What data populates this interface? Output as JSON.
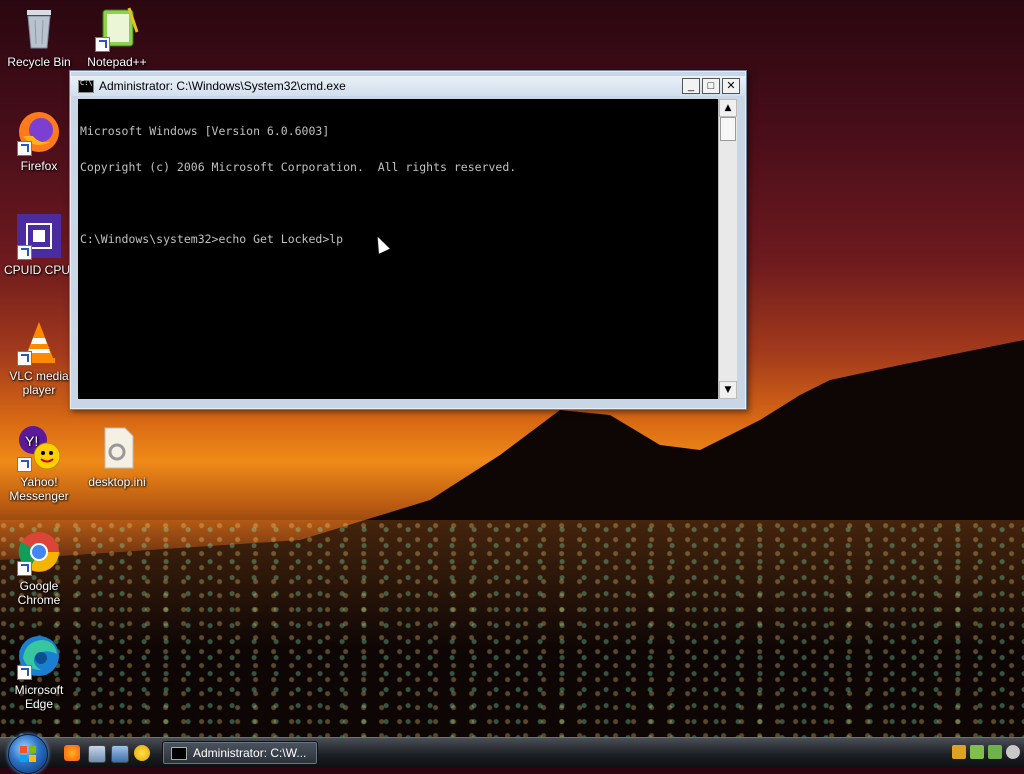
{
  "desktop": {
    "icons": [
      {
        "label": "Recycle Bin"
      },
      {
        "label": "Notepad++"
      },
      {
        "label": "Firefox"
      },
      {
        "label": "CPUID CPU-"
      },
      {
        "label": "VLC media player"
      },
      {
        "label": "Yahoo! Messenger"
      },
      {
        "label": "desktop.ini"
      },
      {
        "label": "Google Chrome"
      },
      {
        "label": "Microsoft Edge"
      }
    ]
  },
  "window": {
    "title": "Administrator: C:\\Windows\\System32\\cmd.exe",
    "console_lines": [
      "Microsoft Windows [Version 6.0.6003]",
      "Copyright (c) 2006 Microsoft Corporation.  All rights reserved.",
      "",
      "C:\\Windows\\system32>echo Get Locked>lp"
    ],
    "controls": {
      "minimize": "_",
      "maximize": "□",
      "close": "✕"
    }
  },
  "taskbar": {
    "task_label": "Administrator: C:\\W...",
    "colors": {
      "accent": "#2b6fc2"
    }
  }
}
